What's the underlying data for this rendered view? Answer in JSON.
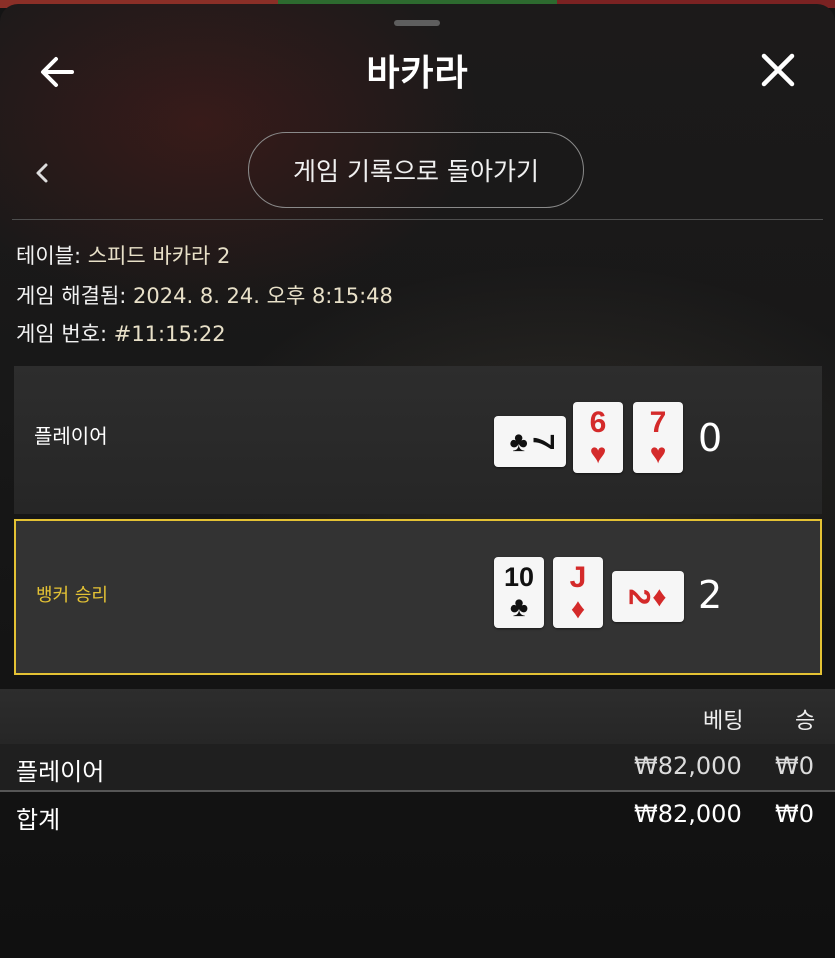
{
  "colors": {
    "accent": "#e4c234",
    "card_red": "#d42a2a",
    "card_black": "#111111"
  },
  "header": {
    "title": "바카라",
    "back_icon": "arrow-left-icon",
    "close_icon": "close-icon"
  },
  "nav": {
    "back_icon": "chevron-left-icon",
    "history_button": "게임 기록으로 돌아가기"
  },
  "info": [
    {
      "label": "테이블:",
      "value": "스피드 바카라 2"
    },
    {
      "label": "게임 해결됨:",
      "value": "2024. 8. 24. 오후 8:15:48"
    },
    {
      "label": "게임 번호:",
      "value": "#11:15:22"
    }
  ],
  "player": {
    "label": "플레이어",
    "score": "0",
    "cards": [
      {
        "rank": "7",
        "suit": "♣",
        "color": "black",
        "orientation": "horizontal"
      },
      {
        "rank": "6",
        "suit": "♥",
        "color": "red",
        "orientation": "vertical"
      },
      {
        "rank": "7",
        "suit": "♥",
        "color": "red",
        "orientation": "vertical"
      }
    ]
  },
  "banker": {
    "label": "뱅커 승리",
    "score": "2",
    "cards": [
      {
        "rank": "10",
        "suit": "♣",
        "color": "black",
        "orientation": "vertical"
      },
      {
        "rank": "J",
        "suit": "♦",
        "color": "red",
        "orientation": "vertical"
      },
      {
        "rank": "2",
        "suit": "♦",
        "color": "red",
        "orientation": "horizontal"
      }
    ]
  },
  "bets": {
    "headers": {
      "bet": "베팅",
      "win": "승"
    },
    "rows": [
      {
        "name": "플레이어",
        "bet": "₩82,000",
        "win": "₩0"
      }
    ],
    "total": {
      "name": "합계",
      "bet": "₩82,000",
      "win": "₩0"
    }
  }
}
